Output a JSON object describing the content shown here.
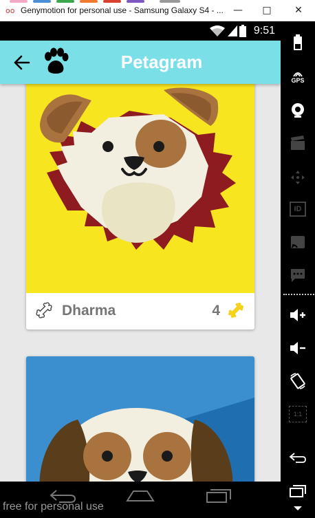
{
  "window": {
    "title": "Genymotion for personal use - Samsung Galaxy S4 - ...",
    "minimize_glyph": "—",
    "maximize_glyph": "□",
    "close_glyph": "✕",
    "app_icon_glyph": "oo"
  },
  "statusbar": {
    "time": "9:51"
  },
  "appbar": {
    "title": "Petagram",
    "back_icon": "arrow-left-icon",
    "logo_icon": "paw-icon"
  },
  "pets": [
    {
      "name": "Dharma",
      "likes": "4",
      "background": "#f7e51f"
    },
    {
      "name": "",
      "likes": "",
      "background": "#3b8fcf"
    }
  ],
  "right_toolbar": {
    "tools": [
      "battery-icon",
      "gps-icon",
      "webcam-icon",
      "clapper-icon",
      "dpad-icon",
      "id-icon",
      "cast-icon",
      "sms-icon",
      "volume-up-icon",
      "volume-down-icon",
      "rotate-icon",
      "scale-icon",
      "back-icon",
      "recent-apps-icon",
      "menu-icon"
    ],
    "gps_label": "GPS",
    "id_label": "ID",
    "scale_label": "1:1"
  },
  "watermark": "free for personal use",
  "colors": {
    "appbar": "#7bdfe8",
    "like_bone": "#f5d31a",
    "text_grey": "#757575"
  }
}
